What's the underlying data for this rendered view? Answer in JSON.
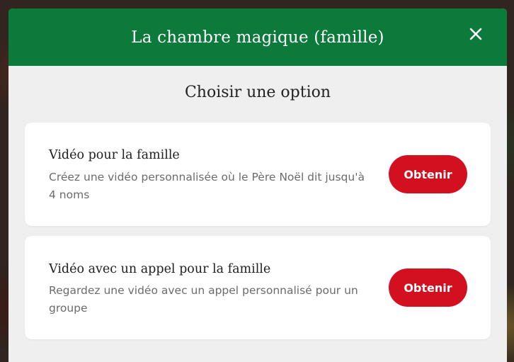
{
  "modal": {
    "title": "La chambre magique (famille)",
    "close_icon": "close-icon",
    "subtitle": "Choisir une option"
  },
  "options": [
    {
      "title": "Vidéo pour la famille",
      "description": "Créez une vidéo personnalisée où le Père Noël dit jusqu'à 4 noms",
      "button_label": "Obtenir"
    },
    {
      "title": "Vidéo avec un appel pour la famille",
      "description": "Regardez une vidéo avec un appel personnalisé pour un groupe",
      "button_label": "Obtenir"
    }
  ],
  "colors": {
    "header_bg": "#0b7a3b",
    "button_bg": "#d3101f",
    "modal_bg": "#efefef",
    "card_bg": "#ffffff"
  }
}
